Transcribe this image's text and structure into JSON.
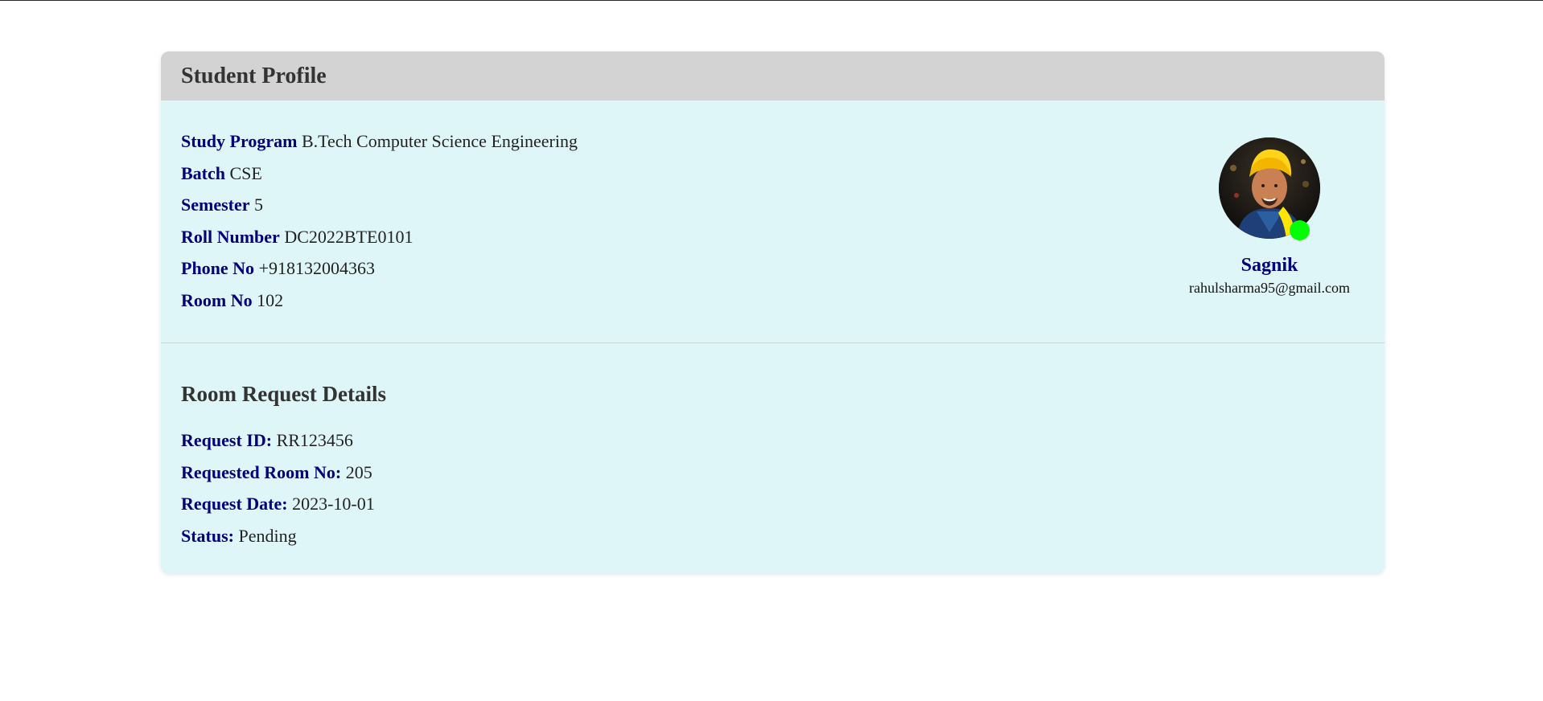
{
  "profile": {
    "title": "Student Profile",
    "fields": [
      {
        "label": "Study Program",
        "value": "B.Tech Computer Science Engineering"
      },
      {
        "label": "Batch",
        "value": "CSE"
      },
      {
        "label": "Semester",
        "value": "5"
      },
      {
        "label": "Roll Number",
        "value": "DC2022BTE0101"
      },
      {
        "label": "Phone No",
        "value": "+918132004363"
      },
      {
        "label": "Room No",
        "value": "102"
      }
    ],
    "name": "Sagnik",
    "email": "rahulsharma95@gmail.com",
    "status_color": "#00ff00"
  },
  "request": {
    "title": "Room Request Details",
    "fields": [
      {
        "label": "Request ID:",
        "value": "RR123456"
      },
      {
        "label": "Requested Room No:",
        "value": "205"
      },
      {
        "label": "Request Date:",
        "value": "2023-10-01"
      },
      {
        "label": "Status:",
        "value": "Pending"
      }
    ]
  },
  "colors": {
    "header_bg": "#d3d3d3",
    "card_bg": "#dff6f8",
    "label": "#00007a"
  }
}
